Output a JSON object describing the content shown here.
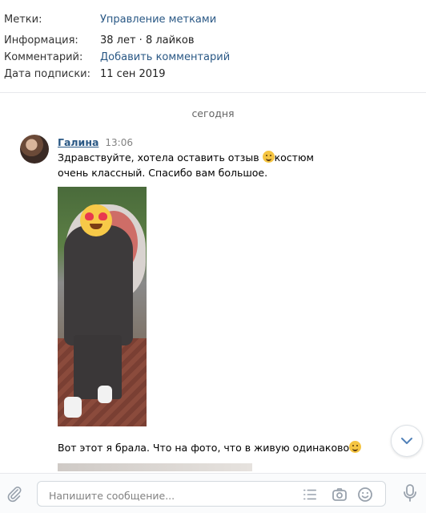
{
  "info": {
    "rows": [
      {
        "label": "Метки:",
        "value": "Управление метками"
      },
      {
        "label": "Информация:",
        "value": "38 лет · 8 лайков"
      },
      {
        "label": "Комментарий:",
        "value": "Добавить комментарий"
      },
      {
        "label": "Дата подписки:",
        "value": "11 сен 2019"
      }
    ]
  },
  "chat": {
    "date_separator": "сегодня",
    "author": "Галина",
    "time": "13:06",
    "text_part1": "Здравствуйте, хотела оставить отзыв ",
    "text_part2": "костюм очень классный. Спасибо вам большое.",
    "text2": "Вот этот я брала. Что на фото, что в живую одинаково"
  },
  "composer": {
    "placeholder": "Напишите сообщение..."
  },
  "colors": {
    "link": "#2a5885",
    "muted": "#828282",
    "icon": "#99a2ad"
  },
  "icons": [
    "paperclip-icon",
    "template-list-icon",
    "camera-icon",
    "smile-icon",
    "microphone-icon",
    "chevron-down-icon"
  ]
}
